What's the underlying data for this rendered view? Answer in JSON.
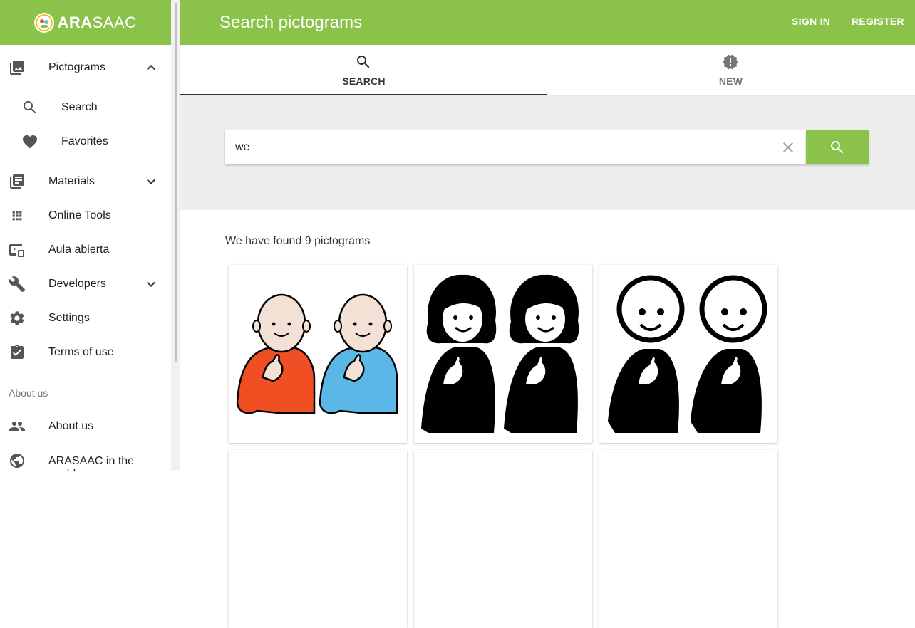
{
  "brand": {
    "logo_bold": "ARA",
    "logo_light": "SAAC"
  },
  "header": {
    "title": "Search pictograms",
    "sign_in": "SIGN IN",
    "register": "REGISTER"
  },
  "sidebar": {
    "items": [
      {
        "label": "Pictograms",
        "icon": "image-library-icon"
      },
      {
        "label": "Search",
        "icon": "search-icon"
      },
      {
        "label": "Favorites",
        "icon": "heart-icon"
      },
      {
        "label": "Materials",
        "icon": "library-books-icon"
      },
      {
        "label": "Online Tools",
        "icon": "apps-grid-icon"
      },
      {
        "label": "Aula abierta",
        "icon": "devices-icon"
      },
      {
        "label": "Developers",
        "icon": "wrench-icon"
      },
      {
        "label": "Settings",
        "icon": "gear-icon"
      },
      {
        "label": "Terms of use",
        "icon": "assignment-check-icon"
      }
    ],
    "section_about": "About us",
    "about_items": [
      {
        "label": "About us",
        "icon": "people-icon"
      },
      {
        "label": "ARASAAC in the world",
        "icon": "globe-icon"
      }
    ]
  },
  "tabs": [
    {
      "label": "SEARCH",
      "icon": "search-icon",
      "active": true
    },
    {
      "label": "NEW",
      "icon": "new-badge-icon",
      "active": false
    }
  ],
  "search": {
    "value": "we"
  },
  "results": {
    "summary": "We have found 9 pictograms",
    "cards": [
      {
        "name": "we-color"
      },
      {
        "name": "we-women-bw"
      },
      {
        "name": "we-simple-bw"
      }
    ]
  },
  "colors": {
    "brand_green": "#8bc34a",
    "shirt_red": "#f04e23",
    "shirt_blue": "#5bb8e6",
    "skin": "#f3e1d6"
  }
}
